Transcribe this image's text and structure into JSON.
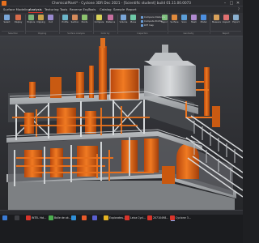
{
  "window": {
    "title": "ChemicalPlant* - Cyclone 3DR Dec 2021 - [Scientific student] build 01.11.00.0073",
    "minimize_glyph": "–",
    "maximize_glyph": "□",
    "close_glyph": "✕"
  },
  "menu": {
    "tabs": [
      "Surface Modeling",
      "Analysis",
      "Texturing",
      "Tools",
      "Reverse Eng",
      "Tools",
      "Catalog",
      "Sample",
      "Report"
    ],
    "active_index": 1,
    "right_glyph": "?"
  },
  "ribbon": {
    "buttons": [
      {
        "label": "Select",
        "icon": "select-icon",
        "color": "#7aa7d9"
      },
      {
        "label": "Display",
        "icon": "display-icon",
        "color": "#d66b4a"
      },
      {
        "label": "Explore",
        "icon": "explore-icon",
        "color": "#7ab37a"
      },
      {
        "label": "Clipping",
        "icon": "clipping-icon",
        "color": "#c9a24a"
      },
      {
        "label": "Cut",
        "icon": "cut-icon",
        "color": "#9a8ad0"
      },
      {
        "label": "Profile",
        "icon": "profile-icon",
        "color": "#6bb5c9"
      },
      {
        "label": "Section",
        "icon": "section-icon",
        "color": "#d48a5b"
      },
      {
        "label": "Points",
        "icon": "points-icon",
        "color": "#8cc36e"
      },
      {
        "label": "Compare",
        "icon": "compare-icon",
        "color": "#d9d35a"
      },
      {
        "label": "Distance",
        "icon": "distance-icon",
        "color": "#c86f9f"
      },
      {
        "label": "Volume",
        "icon": "volume-icon",
        "color": "#7aa7d9"
      },
      {
        "label": "Plane",
        "icon": "plane-icon",
        "color": "#6ec9a8"
      },
      {
        "label": "Surface",
        "icon": "surface-icon",
        "color": "#e08a3c"
      },
      {
        "label": "Scan",
        "icon": "scan-icon",
        "color": "#5c9fd8"
      },
      {
        "label": "Mesh",
        "icon": "mesh-icon",
        "color": "#b08ad0"
      },
      {
        "label": "Model",
        "icon": "model-icon",
        "color": "#4c8fe0"
      },
      {
        "label": "Measure",
        "icon": "measure-icon",
        "color": "#d9a15a"
      },
      {
        "label": "Inspect",
        "icon": "inspect-icon",
        "color": "#e07070"
      },
      {
        "label": "Export",
        "icon": "export-icon",
        "color": "#8ab0d0"
      },
      {
        "label": "Report",
        "icon": "report-icon",
        "color": "#7ec07e"
      }
    ],
    "rows": [
      {
        "label": "Compare Distance"
      },
      {
        "label": "Compute Profile"
      },
      {
        "label": "Diff map"
      }
    ],
    "groups": [
      "Selection",
      "Clipping",
      "Surface Analysis",
      "Color by",
      "Inspection",
      "Geometry",
      "Report"
    ]
  },
  "viewport": {
    "scene": "3d-chemical-plant-model"
  },
  "statusbar": {
    "text": ""
  },
  "taskbar": {
    "items": [
      {
        "label": "",
        "icon": "search-taskbar-icon",
        "color": "#3a7bd5"
      },
      {
        "label": "",
        "icon": "files-taskbar-icon",
        "color": "#3c3d42"
      },
      {
        "label": "INTEL Hol...",
        "icon": "app-taskbar-icon",
        "color": "#d9342b"
      },
      {
        "label": "Bolle de ok...",
        "icon": "chrome-taskbar-icon",
        "color": "#4caf50"
      },
      {
        "label": "",
        "icon": "edge-taskbar-icon",
        "color": "#2f8fd8"
      },
      {
        "label": "",
        "icon": "mail-taskbar-icon",
        "color": "#e85a2a"
      },
      {
        "label": "",
        "icon": "teams-taskbar-icon",
        "color": "#5a5fd0"
      },
      {
        "label": "Explorateu...",
        "icon": "explorer-taskbar-icon",
        "color": "#e6b422"
      },
      {
        "label": "Leica Cycl...",
        "icon": "leica-taskbar-icon",
        "color": "#d9342b"
      },
      {
        "label": "20710498...",
        "icon": "doc-taskbar-icon",
        "color": "#d9342b"
      },
      {
        "label": "Cyclone 3...",
        "icon": "cyclone-taskbar-icon",
        "color": "#d9342b"
      }
    ],
    "active_index": 10
  }
}
